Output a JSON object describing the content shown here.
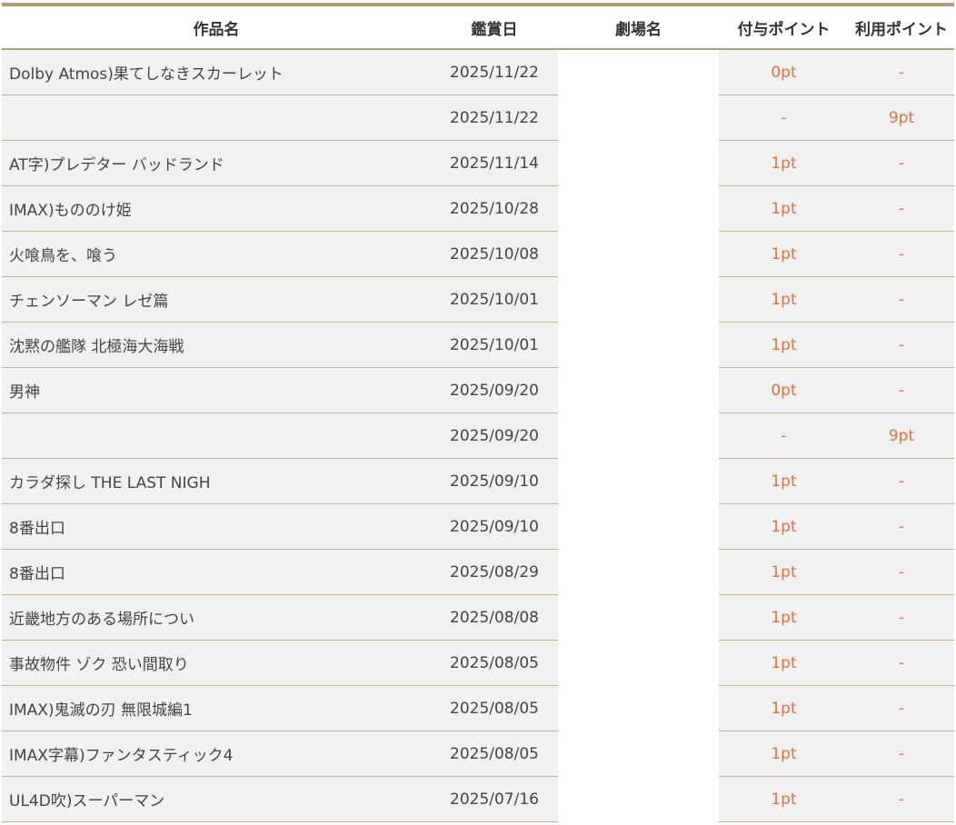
{
  "table": {
    "headers": {
      "title": "作品名",
      "date": "鑑賞日",
      "theater": "劇場名",
      "grant_points": "付与ポイント",
      "use_points": "利用ポイント"
    },
    "rows": [
      {
        "title": "Dolby Atmos)果てしなきスカーレット",
        "date": "2025/11/22",
        "theater": "",
        "grant": "0pt",
        "use": "-"
      },
      {
        "title": "",
        "date": "2025/11/22",
        "theater": "",
        "grant": "-",
        "use": "9pt"
      },
      {
        "title": "AT字)プレデター バッドランド",
        "date": "2025/11/14",
        "theater": "",
        "grant": "1pt",
        "use": "-"
      },
      {
        "title": "IMAX)もののけ姫",
        "date": "2025/10/28",
        "theater": "",
        "grant": "1pt",
        "use": "-"
      },
      {
        "title": "火喰鳥を、喰う",
        "date": "2025/10/08",
        "theater": "",
        "grant": "1pt",
        "use": "-"
      },
      {
        "title": "チェンソーマン レゼ篇",
        "date": "2025/10/01",
        "theater": "",
        "grant": "1pt",
        "use": "-"
      },
      {
        "title": "沈黙の艦隊 北極海大海戦",
        "date": "2025/10/01",
        "theater": "",
        "grant": "1pt",
        "use": "-"
      },
      {
        "title": "男神",
        "date": "2025/09/20",
        "theater": "",
        "grant": "0pt",
        "use": "-"
      },
      {
        "title": "",
        "date": "2025/09/20",
        "theater": "",
        "grant": "-",
        "use": "9pt"
      },
      {
        "title": "カラダ探し THE LAST NIGH",
        "date": "2025/09/10",
        "theater": "",
        "grant": "1pt",
        "use": "-"
      },
      {
        "title": "8番出口",
        "date": "2025/09/10",
        "theater": "",
        "grant": "1pt",
        "use": "-"
      },
      {
        "title": "8番出口",
        "date": "2025/08/29",
        "theater": "",
        "grant": "1pt",
        "use": "-"
      },
      {
        "title": "近畿地方のある場所につい",
        "date": "2025/08/08",
        "theater": "",
        "grant": "1pt",
        "use": "-"
      },
      {
        "title": "事故物件 ゾク 恐い間取り",
        "date": "2025/08/05",
        "theater": "",
        "grant": "1pt",
        "use": "-"
      },
      {
        "title": "IMAX)鬼滅の刃 無限城編1",
        "date": "2025/08/05",
        "theater": "",
        "grant": "1pt",
        "use": "-"
      },
      {
        "title": "IMAX字幕)ファンタスティック4",
        "date": "2025/08/05",
        "theater": "",
        "grant": "1pt",
        "use": "-"
      },
      {
        "title": "UL4D吹)スーパーマン",
        "date": "2025/07/16",
        "theater": "",
        "grant": "1pt",
        "use": "-"
      }
    ]
  },
  "colors": {
    "accent_rule": "#ad9f72",
    "row_border": "#c2b48a",
    "row_bg": "#f1f1f1",
    "point_text": "#e0703c",
    "text": "#444444"
  }
}
